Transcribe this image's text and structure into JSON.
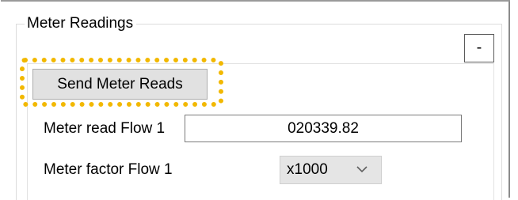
{
  "group": {
    "title": "Meter Readings",
    "collapse_label": "-"
  },
  "actions": {
    "send_label": "Send Meter Reads"
  },
  "fields": {
    "flow_label": "Meter read Flow 1",
    "flow_value": "020339.82",
    "factor_label": "Meter factor Flow 1",
    "factor_value": "x1000"
  },
  "icons": {
    "dropdown": "chevron-down-icon"
  },
  "colors": {
    "highlight": "#f2b800",
    "button_face": "#e1e1e1"
  }
}
